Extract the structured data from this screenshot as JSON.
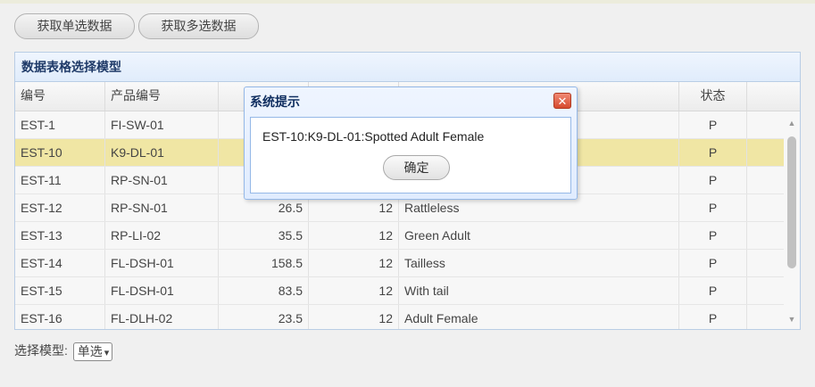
{
  "toolbar": {
    "single_label": "获取单选数据",
    "multi_label": "获取多选数据"
  },
  "panel": {
    "title": "数据表格选择模型"
  },
  "columns": [
    "编号",
    "产品编号",
    "",
    "",
    "",
    "状态"
  ],
  "rows": [
    {
      "item": "EST-1",
      "product": "FI-SW-01",
      "list_price": "",
      "unit_cost": "",
      "attr": "",
      "status": "P"
    },
    {
      "item": "EST-10",
      "product": "K9-DL-01",
      "list_price": "",
      "unit_cost": "",
      "attr": "",
      "status": "P"
    },
    {
      "item": "EST-11",
      "product": "RP-SN-01",
      "list_price": "",
      "unit_cost": "",
      "attr": "",
      "status": "P"
    },
    {
      "item": "EST-12",
      "product": "RP-SN-01",
      "list_price": "26.5",
      "unit_cost": "12",
      "attr": "Rattleless",
      "status": "P"
    },
    {
      "item": "EST-13",
      "product": "RP-LI-02",
      "list_price": "35.5",
      "unit_cost": "12",
      "attr": "Green Adult",
      "status": "P"
    },
    {
      "item": "EST-14",
      "product": "FL-DSH-01",
      "list_price": "158.5",
      "unit_cost": "12",
      "attr": "Tailless",
      "status": "P"
    },
    {
      "item": "EST-15",
      "product": "FL-DSH-01",
      "list_price": "83.5",
      "unit_cost": "12",
      "attr": "With tail",
      "status": "P"
    },
    {
      "item": "EST-16",
      "product": "FL-DLH-02",
      "list_price": "23.5",
      "unit_cost": "12",
      "attr": "Adult Female",
      "status": "P"
    }
  ],
  "selected_row": 1,
  "scrollbar": {
    "up_icon": "triangle-up",
    "down_icon": "triangle-down"
  },
  "footer": {
    "label": "选择模型:",
    "select_value": "单选"
  },
  "dialog": {
    "title": "系统提示",
    "message": "EST-10:K9-DL-01:Spotted Adult Female",
    "ok_label": "确定",
    "close_icon": "close-icon"
  },
  "colors": {
    "selected_row": "#f0e6a4",
    "header_text": "#1f3a68",
    "close_button": "#d64a2e"
  }
}
